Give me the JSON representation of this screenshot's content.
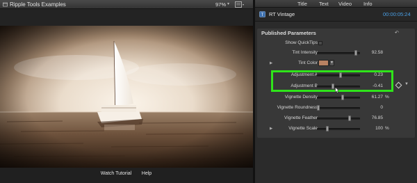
{
  "viewer": {
    "title": "Ripple Tools Examples",
    "zoom": "97%",
    "view_label": "View",
    "watch_tutorial": "Watch Tutorial",
    "help": "Help"
  },
  "inspector": {
    "tabs": [
      "Title",
      "Text",
      "Video",
      "Info"
    ],
    "clip_name": "RT Vintage",
    "timecode": "00:00:05:24",
    "section_title": "Published Parameters",
    "params": [
      {
        "label": "Show QuickTips",
        "kind": "checkbox"
      },
      {
        "label": "Tint Intensity",
        "kind": "slider",
        "value": "92.58",
        "fill": 0.93
      },
      {
        "label": "Tint Color",
        "kind": "color",
        "color": "#b88262"
      },
      {
        "label": "Adjustment A",
        "kind": "slider",
        "value": "0.23",
        "fill": 0.55
      },
      {
        "label": "Adjustment B",
        "kind": "slider",
        "value": "-0.41",
        "fill": 0.37
      },
      {
        "label": "Vignette Density",
        "kind": "slider",
        "value": "61.27",
        "unit": "%",
        "fill": 0.61
      },
      {
        "label": "Vignette Roundness",
        "kind": "slider",
        "value": "0",
        "fill": 0.0
      },
      {
        "label": "Vignette Feather",
        "kind": "slider",
        "value": "76.85",
        "fill": 0.77
      },
      {
        "label": "Vignette Scale",
        "kind": "slider",
        "value": "100",
        "unit": "%",
        "fill": 0.22
      }
    ]
  },
  "colors": {
    "highlight": "#2fe41a",
    "timecode": "#4aa0e6",
    "sepia": "#6a4a30"
  },
  "icons": {
    "reset": "reset-arrow-icon",
    "keyframe": "keyframe-diamond-icon"
  }
}
